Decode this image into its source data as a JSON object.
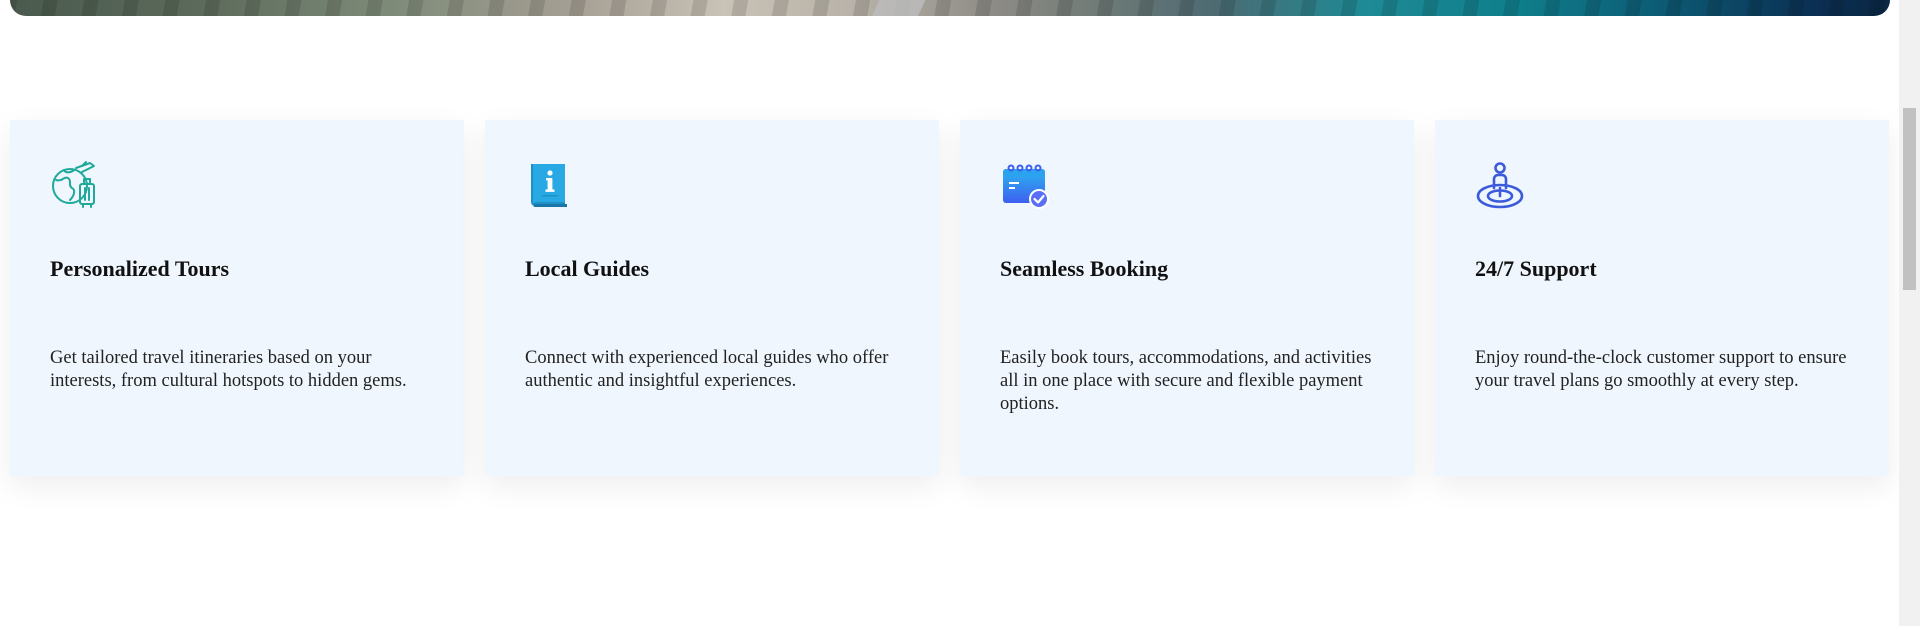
{
  "hero": {
    "description": ""
  },
  "features": [
    {
      "icon": "globe-luggage-icon",
      "title": "Personalized Tours",
      "text": "Get tailored travel itineraries based on your interests, from cultural hotspots to hidden gems."
    },
    {
      "icon": "info-book-icon",
      "title": "Local Guides",
      "text": "Connect with experienced local guides who offer authentic and insightful experiences."
    },
    {
      "icon": "calendar-check-icon",
      "title": "Seamless Booking",
      "text": "Easily book tours, accommodations, and activities all in one place with secure and flexible payment options."
    },
    {
      "icon": "location-person-icon",
      "title": "24/7 Support",
      "text": "Enjoy round-the-clock customer support to ensure your travel plans go smoothly at every step."
    }
  ],
  "colors": {
    "card_bg": "#eff6fd",
    "teal_icon": "#1fa99a",
    "blue_book": "#29a3dd",
    "calendar_blue": "#3b7bf5",
    "support_blue": "#3b5bdb"
  }
}
